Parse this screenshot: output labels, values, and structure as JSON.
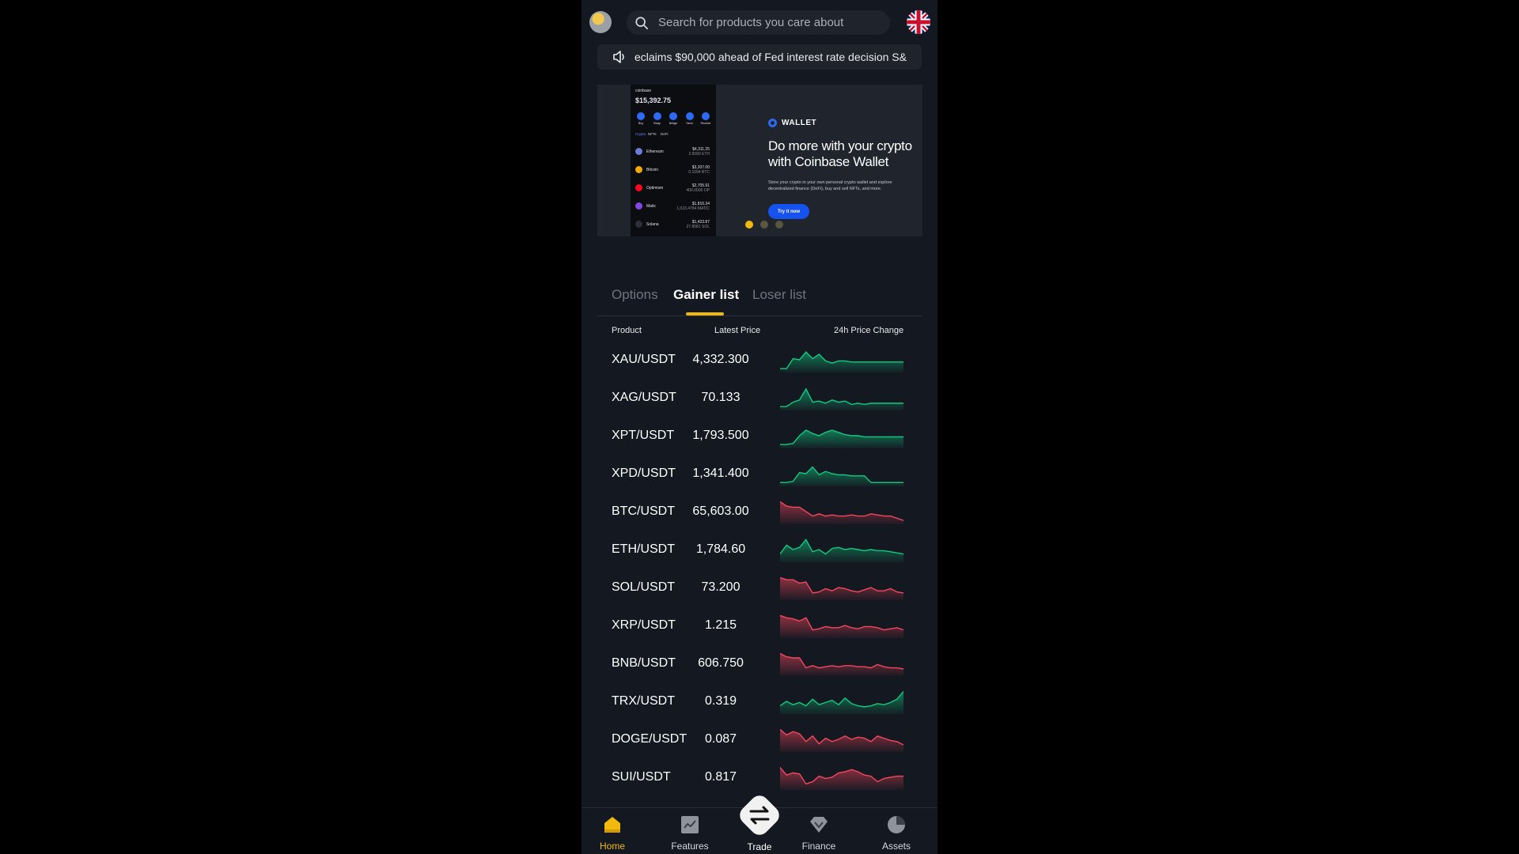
{
  "search": {
    "placeholder": "Search for products you care about"
  },
  "ticker": {
    "text": "eclaims $90,000 ahead of Fed interest rate decision   S&"
  },
  "banner": {
    "wallet_label": "WALLET",
    "headline_line1": "Do more with your crypto",
    "headline_line2": "with Coinbase Wallet",
    "description": "Store your crypto in your own personal crypto wallet and explore decentralized finance (DeFi), buy and sell NFTs, and more.",
    "cta": "Try it now",
    "phone": {
      "brand": "coinbase",
      "balance": "$15,392.75",
      "actions": [
        "Buy",
        "Swap",
        "Bridge",
        "Send",
        "Receive"
      ],
      "tabs": [
        "Crypto",
        "NFTs",
        "DeFi"
      ],
      "coins": [
        {
          "name": "Ethereum",
          "value": "$4,311.25",
          "sub": "2.9090 ETH",
          "color": "#6b7bd6"
        },
        {
          "name": "Bitcoin",
          "value": "$3,207.00",
          "sub": "0.1094 BTC",
          "color": "#f2a900"
        },
        {
          "name": "Optimism",
          "value": "$2,705.91",
          "sub": "400.0000 OP",
          "color": "#ff0420"
        },
        {
          "name": "Matic",
          "value": "$1,816.34",
          "sub": "1,023.4784 MATIC",
          "color": "#8247e5"
        },
        {
          "name": "Solana",
          "value": "$1,423.87",
          "sub": "27.8081 SOL",
          "color": "#2b2f38"
        }
      ],
      "active_slide": 0,
      "slides": 3
    }
  },
  "tabs": [
    "Options",
    "Gainer list",
    "Loser list"
  ],
  "active_tab": 1,
  "columns": {
    "product": "Product",
    "price": "Latest Price",
    "change": "24h Price Change"
  },
  "rows": [
    {
      "symbol": "XAU/USDT",
      "price": "4,332.300",
      "trend": "up",
      "spark": [
        0.1,
        0.1,
        0.55,
        0.5,
        0.85,
        0.55,
        0.75,
        0.45,
        0.35,
        0.45,
        0.45,
        0.4,
        0.4,
        0.4,
        0.4,
        0.4,
        0.4,
        0.4,
        0.4,
        0.4
      ]
    },
    {
      "symbol": "XAG/USDT",
      "price": "70.133",
      "trend": "up",
      "spark": [
        0.1,
        0.1,
        0.3,
        0.4,
        0.9,
        0.3,
        0.35,
        0.25,
        0.4,
        0.3,
        0.35,
        0.2,
        0.25,
        0.2,
        0.25,
        0.25,
        0.25,
        0.25,
        0.25,
        0.25
      ]
    },
    {
      "symbol": "XPT/USDT",
      "price": "1,793.500",
      "trend": "up",
      "spark": [
        0.1,
        0.1,
        0.15,
        0.5,
        0.75,
        0.6,
        0.5,
        0.65,
        0.75,
        0.65,
        0.55,
        0.5,
        0.5,
        0.45,
        0.45,
        0.45,
        0.45,
        0.45,
        0.45,
        0.45
      ]
    },
    {
      "symbol": "XPD/USDT",
      "price": "1,341.400",
      "trend": "up",
      "spark": [
        0.1,
        0.1,
        0.15,
        0.55,
        0.5,
        0.8,
        0.45,
        0.6,
        0.5,
        0.45,
        0.45,
        0.4,
        0.4,
        0.4,
        0.1,
        0.1,
        0.1,
        0.1,
        0.1,
        0.1
      ]
    },
    {
      "symbol": "BTC/USDT",
      "price": "65,603.00",
      "trend": "down",
      "spark": [
        0.95,
        0.75,
        0.7,
        0.7,
        0.5,
        0.3,
        0.4,
        0.3,
        0.35,
        0.3,
        0.3,
        0.35,
        0.3,
        0.3,
        0.4,
        0.35,
        0.3,
        0.3,
        0.2,
        0.1
      ]
    },
    {
      "symbol": "ETH/USDT",
      "price": "1,784.60",
      "trend": "up",
      "spark": [
        0.3,
        0.7,
        0.5,
        0.6,
        0.95,
        0.4,
        0.5,
        0.3,
        0.55,
        0.6,
        0.5,
        0.55,
        0.5,
        0.45,
        0.5,
        0.45,
        0.45,
        0.4,
        0.35,
        0.3
      ]
    },
    {
      "symbol": "SOL/USDT",
      "price": "73.200",
      "trend": "down",
      "spark": [
        0.95,
        0.85,
        0.85,
        0.7,
        0.75,
        0.25,
        0.3,
        0.45,
        0.35,
        0.5,
        0.45,
        0.35,
        0.3,
        0.4,
        0.5,
        0.35,
        0.35,
        0.45,
        0.3,
        0.25
      ]
    },
    {
      "symbol": "XRP/USDT",
      "price": "1.215",
      "trend": "down",
      "spark": [
        0.95,
        0.85,
        0.8,
        0.7,
        0.85,
        0.3,
        0.35,
        0.45,
        0.4,
        0.4,
        0.5,
        0.4,
        0.35,
        0.45,
        0.45,
        0.4,
        0.3,
        0.35,
        0.4,
        0.3
      ]
    },
    {
      "symbol": "BNB/USDT",
      "price": "606.750",
      "trend": "down",
      "spark": [
        0.95,
        0.8,
        0.75,
        0.75,
        0.3,
        0.4,
        0.3,
        0.35,
        0.4,
        0.35,
        0.4,
        0.4,
        0.35,
        0.35,
        0.3,
        0.45,
        0.35,
        0.3,
        0.3,
        0.25
      ]
    },
    {
      "symbol": "TRX/USDT",
      "price": "0.319",
      "trend": "up",
      "spark": [
        0.3,
        0.5,
        0.35,
        0.45,
        0.3,
        0.6,
        0.35,
        0.45,
        0.55,
        0.35,
        0.65,
        0.4,
        0.3,
        0.25,
        0.3,
        0.4,
        0.35,
        0.45,
        0.6,
        0.95
      ]
    },
    {
      "symbol": "DOGE/USDT",
      "price": "0.087",
      "trend": "down",
      "spark": [
        0.95,
        0.7,
        0.85,
        0.75,
        0.4,
        0.65,
        0.3,
        0.55,
        0.4,
        0.5,
        0.65,
        0.5,
        0.6,
        0.55,
        0.4,
        0.65,
        0.55,
        0.45,
        0.4,
        0.25
      ]
    },
    {
      "symbol": "SUI/USDT",
      "price": "0.817",
      "trend": "down",
      "spark": [
        0.95,
        0.6,
        0.7,
        0.65,
        0.2,
        0.3,
        0.55,
        0.45,
        0.5,
        0.7,
        0.75,
        0.85,
        0.75,
        0.6,
        0.55,
        0.3,
        0.45,
        0.5,
        0.55,
        0.55
      ]
    }
  ],
  "nav": {
    "items": [
      {
        "label": "Home",
        "icon": "home-icon",
        "active": true
      },
      {
        "label": "Features",
        "icon": "chart-icon",
        "active": false
      },
      {
        "label": "Trade",
        "icon": "swap-icon",
        "active": false
      },
      {
        "label": "Finance",
        "icon": "diamond-icon",
        "active": false
      },
      {
        "label": "Assets",
        "icon": "pie-icon",
        "active": false
      }
    ]
  },
  "colors": {
    "accent": "#f0b90b",
    "up": "#0ecb81",
    "down": "#f6465d",
    "background": "#141820"
  }
}
